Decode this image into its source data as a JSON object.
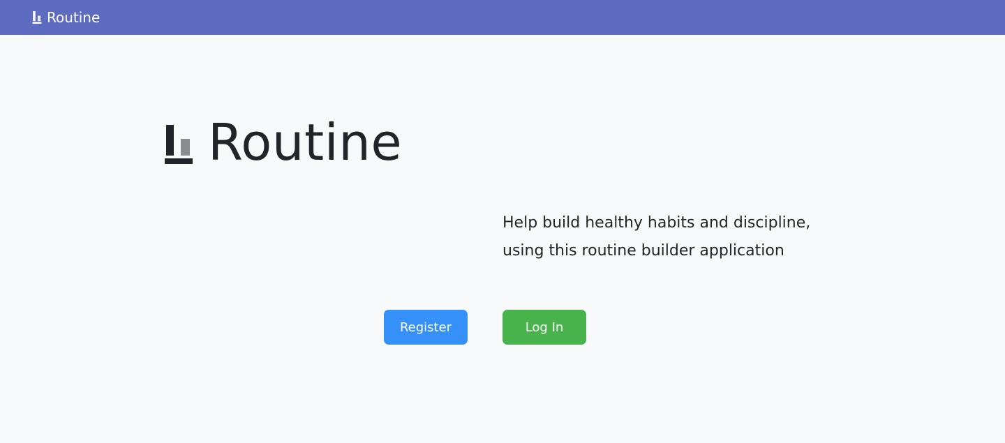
{
  "navbar": {
    "brand_label": "Routine",
    "brand_icon": "routine-logo-icon",
    "background": "#5d6bc1"
  },
  "hero": {
    "title": "Routine",
    "logo_icon": "routine-logo-icon",
    "tagline_line1": "Help build healthy habits and discipline,",
    "tagline_line2": "using this routine builder application"
  },
  "actions": {
    "register_label": "Register",
    "register_color": "#3590f7",
    "login_label": "Log In",
    "login_color": "#48b34d"
  }
}
